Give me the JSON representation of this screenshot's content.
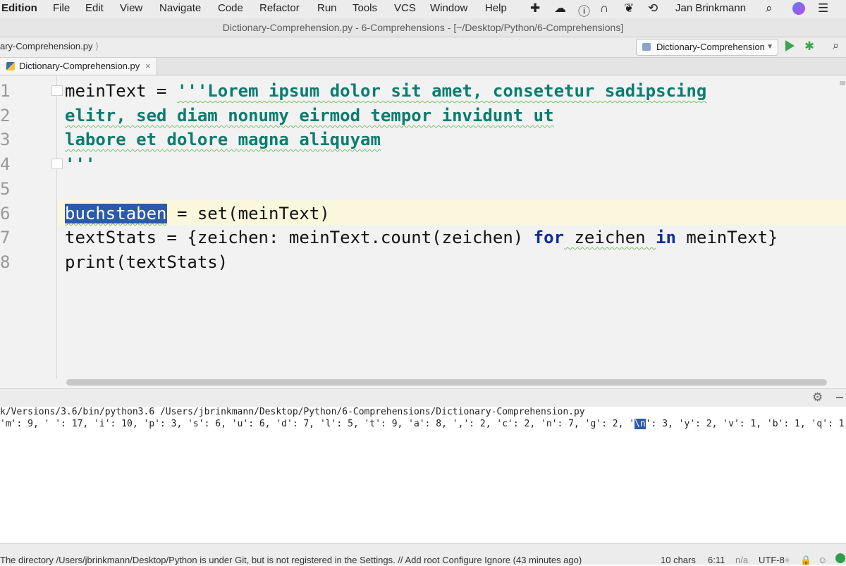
{
  "menubar": {
    "app_name": "Edition",
    "items": [
      "File",
      "Edit",
      "View",
      "Navigate",
      "Code",
      "Refactor",
      "Run",
      "Tools",
      "VCS",
      "Window",
      "Help"
    ],
    "tray_icons": [
      "plus-cross-icon",
      "creative-cloud-icon",
      "info-icon",
      "headset-icon",
      "leaf-icon",
      "time-machine-icon"
    ],
    "user": "Jan Brinkmann",
    "right_icons": [
      "search-icon",
      "siri-icon",
      "list-icon"
    ]
  },
  "window": {
    "title": "Dictionary-Comprehension.py - 6-Comprehensions - [~/Desktop/Python/6-Comprehensions]"
  },
  "navbar": {
    "breadcrumb": "ary-Comprehension.py",
    "run_config": "Dictionary-Comprehension"
  },
  "tabs": [
    {
      "label": "Dictionary-Comprehension.py",
      "close": "×"
    }
  ],
  "editor": {
    "line_numbers": [
      "1",
      "2",
      "3",
      "4",
      "5",
      "6",
      "7",
      "8"
    ],
    "lines": {
      "l1_var": "meinText",
      "l1_op": " = ",
      "l1_str": "'''Lorem ipsum dolor sit amet, consetetur sadipscing",
      "l2_str": "elitr, sed diam nonumy eirmod tempor invidunt ut",
      "l3_str": "labore et dolore magna aliquyam",
      "l4_str": "'''",
      "l6_selected": "buchstaben",
      "l6_rest": " = set(meinText)",
      "l7_a": "textStats = {zeichen: meinText.count(zeichen) ",
      "l7_for": "for",
      "l7_b": " zeichen ",
      "l7_in": "in",
      "l7_c": " meinText}",
      "l8": "print(textStats)"
    }
  },
  "console": {
    "command": "k/Versions/3.6/bin/python3.6 /Users/jbrinkmann/Desktop/Python/6-Comprehensions/Dictionary-Comprehension.py",
    "output_before": "'m': 9, ' ': 17, 'i': 10, 'p': 3, 's': 6, 'u': 6, 'd': 7, 'l': 5, 't': 9, 'a': 8, ',': 2, 'c': 2, 'n': 7, 'g': 2, '",
    "output_highlight": "\\n",
    "output_after": "': 3, 'y': 2, 'v': 1, 'b': 1, 'q': 1"
  },
  "statusbar": {
    "message": "The directory /Users/jbrinkmann/Desktop/Python is under Git, but is not registered in the Settings. // Add root  Configure  Ignore (43 minutes ago)",
    "chars": "10 chars",
    "position": "6:11",
    "na": "n/a",
    "encoding": "UTF-8÷"
  }
}
